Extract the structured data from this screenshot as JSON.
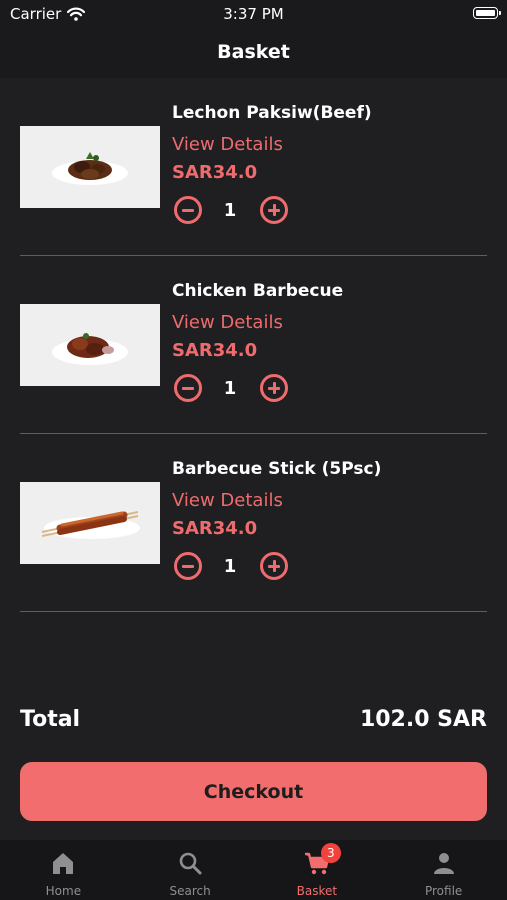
{
  "status_bar": {
    "carrier": "Carrier",
    "time": "3:37 PM"
  },
  "nav": {
    "title": "Basket"
  },
  "items": [
    {
      "name": "Lechon Paksiw(Beef)",
      "view_details": "View Details",
      "price": "SAR34.0",
      "quantity": "1"
    },
    {
      "name": "Chicken Barbecue",
      "view_details": "View Details",
      "price": "SAR34.0",
      "quantity": "1"
    },
    {
      "name": "Barbecue Stick (5Psc)",
      "view_details": "View Details",
      "price": "SAR34.0",
      "quantity": "1"
    }
  ],
  "summary": {
    "total_label": "Total",
    "total_value": "102.0 SAR"
  },
  "checkout": {
    "label": "Checkout"
  },
  "tabs": [
    {
      "label": "Home",
      "icon": "home-icon"
    },
    {
      "label": "Search",
      "icon": "search-icon"
    },
    {
      "label": "Basket",
      "icon": "cart-icon",
      "badge": "3",
      "active": true
    },
    {
      "label": "Profile",
      "icon": "person-icon"
    }
  ],
  "colors": {
    "accent": "#f26d6e",
    "background": "#1f1f21",
    "badge": "#f2423b"
  }
}
